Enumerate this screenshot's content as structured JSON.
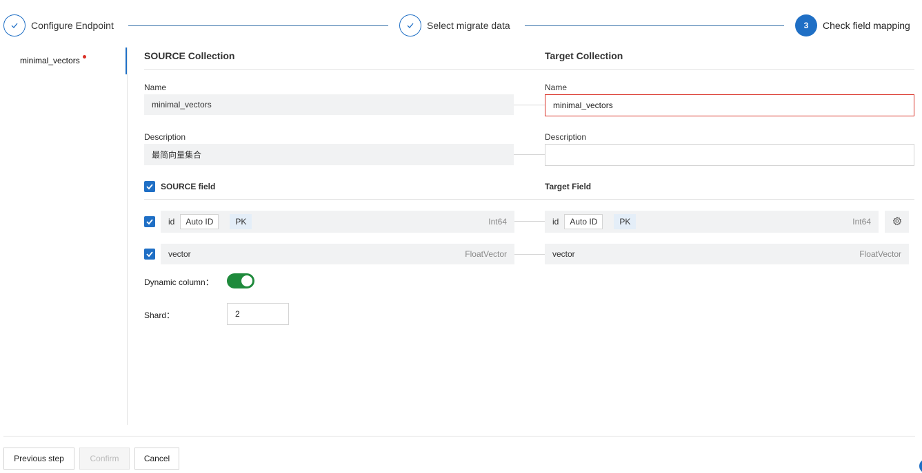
{
  "colors": {
    "accent": "#1f6fc5",
    "toggle_on": "#1f8a3c",
    "error": "#d93026",
    "readonly_bg": "#f1f2f3"
  },
  "stepper": {
    "steps": [
      {
        "label": "Configure Endpoint",
        "state": "done",
        "icon": "check-icon"
      },
      {
        "label": "Select migrate data",
        "state": "done",
        "icon": "check-icon"
      },
      {
        "label": "Check field mapping",
        "state": "active",
        "number": "3"
      }
    ]
  },
  "collections_list": {
    "items": [
      {
        "label": "minimal_vectors",
        "has_error": true
      }
    ]
  },
  "source": {
    "title": "SOURCE Collection",
    "name_label": "Name",
    "name_value": "minimal_vectors",
    "description_label": "Description",
    "description_value": "最简向量集合",
    "fields_title": "SOURCE field",
    "fields": [
      {
        "name": "id",
        "auto_id": "Auto ID",
        "pk": "PK",
        "type": "Int64"
      },
      {
        "name": "vector",
        "type": "FloatVector"
      }
    ]
  },
  "target": {
    "title": "Target Collection",
    "name_label": "Name",
    "name_value": "minimal_vectors",
    "description_label": "Description",
    "description_value": "",
    "fields_title": "Target Field",
    "fields": [
      {
        "name": "id",
        "auto_id": "Auto ID",
        "pk": "PK",
        "type": "Int64"
      },
      {
        "name": "vector",
        "type": "FloatVector"
      }
    ]
  },
  "options": {
    "dynamic_column_label": "Dynamic column：",
    "dynamic_column_enabled": true,
    "shard_label": "Shard：",
    "shard_value": "2"
  },
  "footer": {
    "previous_label": "Previous step",
    "confirm_label": "Confirm",
    "cancel_label": "Cancel"
  }
}
